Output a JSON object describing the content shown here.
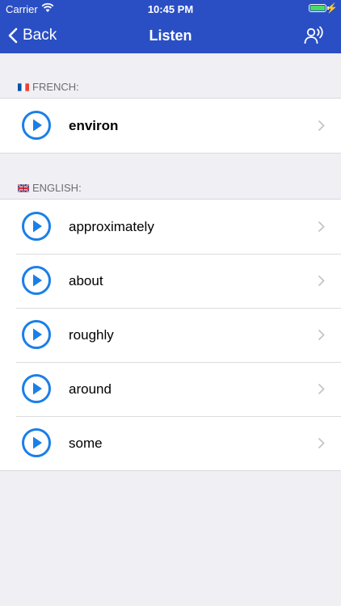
{
  "status": {
    "carrier": "Carrier",
    "time": "10:45 PM"
  },
  "nav": {
    "back_label": "Back",
    "title": "Listen"
  },
  "sections": {
    "french": {
      "label": "FRENCH:",
      "words": [
        "environ"
      ]
    },
    "english": {
      "label": "ENGLISH:",
      "words": [
        "approximately",
        "about",
        "roughly",
        "around",
        "some"
      ]
    }
  },
  "colors": {
    "accent": "#2a4fc4",
    "play": "#1a7fe8",
    "background": "#efeff4"
  }
}
